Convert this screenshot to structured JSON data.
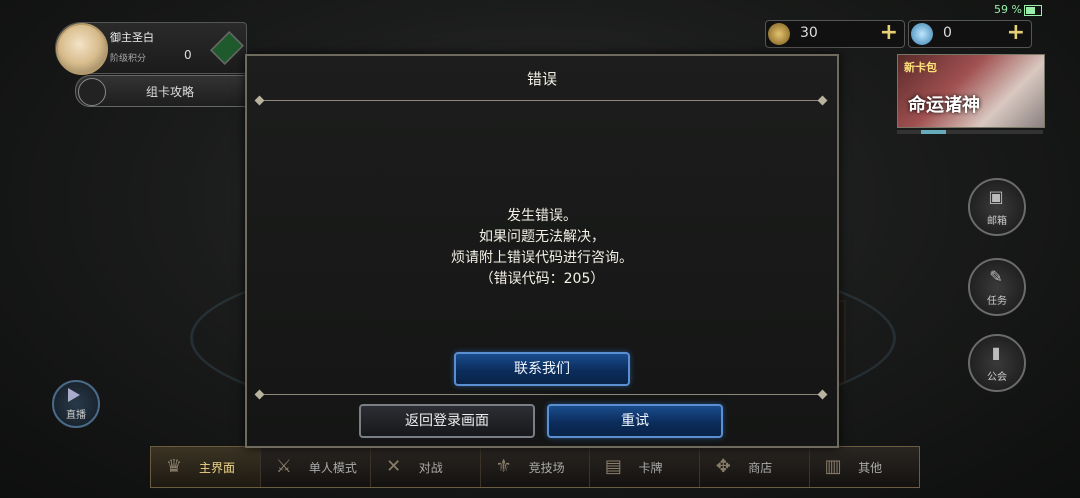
{
  "status_bar": {
    "battery": "59 %"
  },
  "profile": {
    "name": "御主圣白",
    "rank": "阶级积分",
    "score": "0"
  },
  "deck_button": {
    "label": "组卡攻略"
  },
  "currency": [
    {
      "icon": "gold-coin-icon",
      "value": "30"
    },
    {
      "icon": "crystal-icon",
      "value": "0"
    }
  ],
  "banner": {
    "tag": "新卡包",
    "title": "命运诸神"
  },
  "right_buttons": [
    {
      "icon": "gift-box-icon",
      "label": "邮箱"
    },
    {
      "icon": "scroll-icon",
      "label": "任务"
    },
    {
      "icon": "bookmark-icon",
      "label": "公会"
    }
  ],
  "live_button": {
    "label": "直播"
  },
  "bottom_nav": [
    {
      "icon": "hat-icon",
      "label": "主界面",
      "active": true
    },
    {
      "icon": "sword-icon",
      "label": "单人模式",
      "active": false
    },
    {
      "icon": "crossed-swords-icon",
      "label": "对战",
      "active": false
    },
    {
      "icon": "arena-icon",
      "label": "竞技场",
      "active": false
    },
    {
      "icon": "cards-icon",
      "label": "卡牌",
      "active": false
    },
    {
      "icon": "shop-icon",
      "label": "商店",
      "active": false
    },
    {
      "icon": "more-icon",
      "label": "其他",
      "active": false
    }
  ],
  "dialog": {
    "title": "错误",
    "lines": [
      "发生错误。",
      "如果问题无法解决，",
      "烦请附上错误代码进行咨询。",
      "（错误代码：205）"
    ],
    "contact_label": "联系我们",
    "back_label": "返回登录画面",
    "retry_label": "重试"
  },
  "colors": {
    "accent_blue": "#1a4c8c",
    "gold": "#e6cf74",
    "panel": "#1c1d1c"
  }
}
